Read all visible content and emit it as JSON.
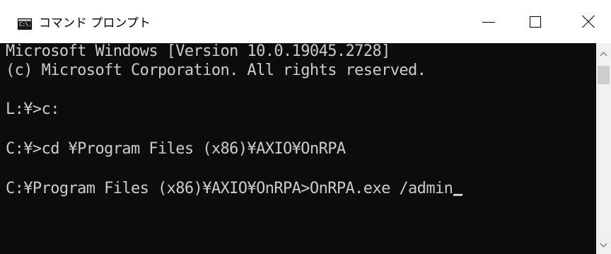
{
  "window": {
    "title": "コマンド プロンプト",
    "icon_name": "command-prompt-icon",
    "icon_text": "C:\\."
  },
  "caption_buttons": {
    "minimize_icon": "minimize-icon",
    "maximize_icon": "maximize-icon",
    "close_icon": "close-icon"
  },
  "console": {
    "background": "#0c0c0c",
    "foreground": "#cccccc",
    "lines": [
      "Microsoft Windows [Version 10.0.19045.2728]",
      "(c) Microsoft Corporation. All rights reserved.",
      "L:¥>c:",
      "C:¥>cd ¥Program Files (x86)¥AXIO¥OnRPA",
      "C:¥Program Files (x86)¥AXIO¥OnRPA>OnRPA.exe /admin"
    ]
  },
  "scrollbar": {
    "up_icon": "scroll-up-arrow-icon",
    "down_icon": "scroll-down-arrow-icon"
  }
}
